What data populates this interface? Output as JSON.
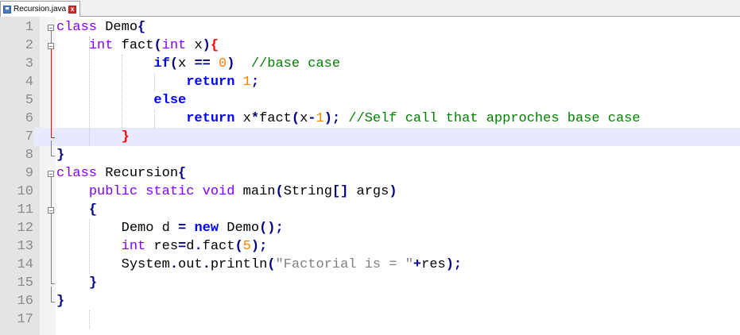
{
  "tab": {
    "title": "Recursion.java",
    "close_glyph": "x"
  },
  "lines": [
    {
      "n": "1",
      "tokens": [
        {
          "t": "class",
          "c": "kw"
        },
        {
          "t": " Demo",
          "c": "pl"
        },
        {
          "t": "{",
          "c": "op"
        }
      ]
    },
    {
      "n": "2",
      "tokens": [
        {
          "t": "    ",
          "c": "pl"
        },
        {
          "t": "int",
          "c": "kw"
        },
        {
          "t": " fact",
          "c": "pl"
        },
        {
          "t": "(",
          "c": "op"
        },
        {
          "t": "int",
          "c": "kw"
        },
        {
          "t": " x",
          "c": "pl"
        },
        {
          "t": ")",
          "c": "op"
        },
        {
          "t": "{",
          "c": "brk"
        }
      ]
    },
    {
      "n": "3",
      "tokens": [
        {
          "t": "            ",
          "c": "pl"
        },
        {
          "t": "if",
          "c": "kwb"
        },
        {
          "t": "(",
          "c": "op"
        },
        {
          "t": "x ",
          "c": "pl"
        },
        {
          "t": "==",
          "c": "op"
        },
        {
          "t": " ",
          "c": "pl"
        },
        {
          "t": "0",
          "c": "num"
        },
        {
          "t": ")",
          "c": "op"
        },
        {
          "t": "  ",
          "c": "pl"
        },
        {
          "t": "//base case",
          "c": "cm"
        }
      ]
    },
    {
      "n": "4",
      "tokens": [
        {
          "t": "                ",
          "c": "pl"
        },
        {
          "t": "return",
          "c": "kwb"
        },
        {
          "t": " ",
          "c": "pl"
        },
        {
          "t": "1",
          "c": "num"
        },
        {
          "t": ";",
          "c": "op"
        }
      ]
    },
    {
      "n": "5",
      "tokens": [
        {
          "t": "            ",
          "c": "pl"
        },
        {
          "t": "else",
          "c": "kwb"
        }
      ]
    },
    {
      "n": "6",
      "tokens": [
        {
          "t": "                ",
          "c": "pl"
        },
        {
          "t": "return",
          "c": "kwb"
        },
        {
          "t": " x",
          "c": "pl"
        },
        {
          "t": "*",
          "c": "op"
        },
        {
          "t": "fact",
          "c": "pl"
        },
        {
          "t": "(",
          "c": "op"
        },
        {
          "t": "x",
          "c": "pl"
        },
        {
          "t": "-",
          "c": "op"
        },
        {
          "t": "1",
          "c": "num"
        },
        {
          "t": ");",
          "c": "op"
        },
        {
          "t": " ",
          "c": "pl"
        },
        {
          "t": "//Self call that approches base case",
          "c": "cm"
        }
      ]
    },
    {
      "n": "7",
      "tokens": [
        {
          "t": "        ",
          "c": "pl"
        },
        {
          "t": "}",
          "c": "brk"
        }
      ],
      "current": true
    },
    {
      "n": "8",
      "tokens": [
        {
          "t": "}",
          "c": "op"
        }
      ]
    },
    {
      "n": "9",
      "tokens": [
        {
          "t": "class",
          "c": "kw"
        },
        {
          "t": " Recursion",
          "c": "pl"
        },
        {
          "t": "{",
          "c": "op"
        }
      ]
    },
    {
      "n": "10",
      "tokens": [
        {
          "t": "    ",
          "c": "pl"
        },
        {
          "t": "public",
          "c": "kw"
        },
        {
          "t": " ",
          "c": "pl"
        },
        {
          "t": "static",
          "c": "kw"
        },
        {
          "t": " ",
          "c": "pl"
        },
        {
          "t": "void",
          "c": "kw"
        },
        {
          "t": " main",
          "c": "pl"
        },
        {
          "t": "(",
          "c": "op"
        },
        {
          "t": "String",
          "c": "pl"
        },
        {
          "t": "[]",
          "c": "op"
        },
        {
          "t": " args",
          "c": "pl"
        },
        {
          "t": ")",
          "c": "op"
        }
      ]
    },
    {
      "n": "11",
      "tokens": [
        {
          "t": "    ",
          "c": "pl"
        },
        {
          "t": "{",
          "c": "op"
        }
      ]
    },
    {
      "n": "12",
      "tokens": [
        {
          "t": "        ",
          "c": "pl"
        },
        {
          "t": "Demo d ",
          "c": "pl"
        },
        {
          "t": "=",
          "c": "op"
        },
        {
          "t": " ",
          "c": "pl"
        },
        {
          "t": "new",
          "c": "kwb"
        },
        {
          "t": " Demo",
          "c": "pl"
        },
        {
          "t": "();",
          "c": "op"
        }
      ]
    },
    {
      "n": "13",
      "tokens": [
        {
          "t": "        ",
          "c": "pl"
        },
        {
          "t": "int",
          "c": "kw"
        },
        {
          "t": " res",
          "c": "pl"
        },
        {
          "t": "=",
          "c": "op"
        },
        {
          "t": "d",
          "c": "pl"
        },
        {
          "t": ".",
          "c": "op"
        },
        {
          "t": "fact",
          "c": "pl"
        },
        {
          "t": "(",
          "c": "op"
        },
        {
          "t": "5",
          "c": "num"
        },
        {
          "t": ");",
          "c": "op"
        }
      ]
    },
    {
      "n": "14",
      "tokens": [
        {
          "t": "        ",
          "c": "pl"
        },
        {
          "t": "System",
          "c": "pl"
        },
        {
          "t": ".",
          "c": "op"
        },
        {
          "t": "out",
          "c": "pl"
        },
        {
          "t": ".",
          "c": "op"
        },
        {
          "t": "println",
          "c": "pl"
        },
        {
          "t": "(",
          "c": "op"
        },
        {
          "t": "\"Factorial is = \"",
          "c": "str"
        },
        {
          "t": "+",
          "c": "op"
        },
        {
          "t": "res",
          "c": "pl"
        },
        {
          "t": ");",
          "c": "op"
        }
      ]
    },
    {
      "n": "15",
      "tokens": [
        {
          "t": "    ",
          "c": "pl"
        },
        {
          "t": "}",
          "c": "op"
        }
      ]
    },
    {
      "n": "16",
      "tokens": [
        {
          "t": "}",
          "c": "op"
        }
      ]
    },
    {
      "n": "17",
      "tokens": []
    }
  ]
}
